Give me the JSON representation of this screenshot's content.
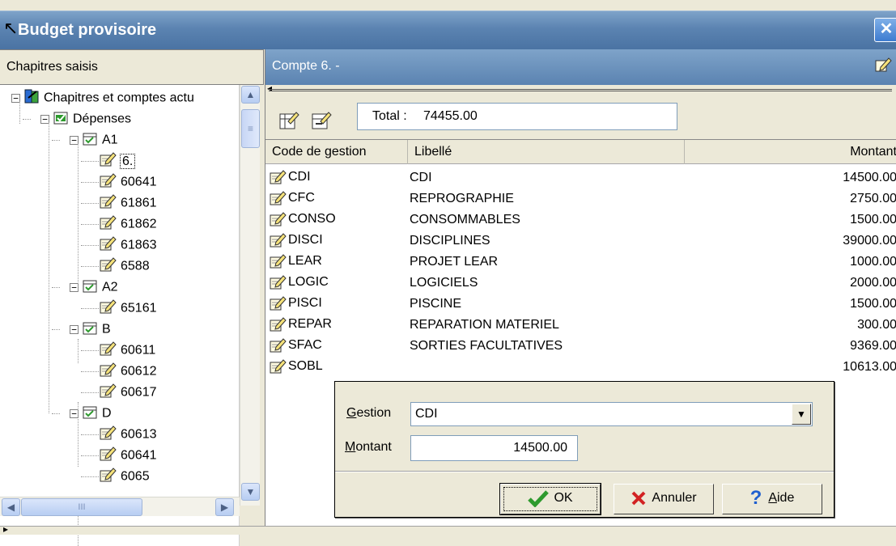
{
  "window": {
    "title": "Budget provisoire",
    "close_symbol": "✕"
  },
  "left": {
    "header": "Chapitres saisis",
    "tree": [
      {
        "level": 0,
        "expander": "−",
        "icon": "chapter-book-icon",
        "label": "Chapitres et comptes actu"
      },
      {
        "level": 1,
        "expander": "−",
        "icon": "expense-folder-icon",
        "label": "Dépenses"
      },
      {
        "level": 2,
        "expander": "−",
        "icon": "chapter-check-icon",
        "label": "A1"
      },
      {
        "level": 3,
        "expander": "",
        "icon": "account-edit-icon",
        "label": "6.",
        "selected": true
      },
      {
        "level": 3,
        "expander": "",
        "icon": "account-edit-icon",
        "label": "60641"
      },
      {
        "level": 3,
        "expander": "",
        "icon": "account-edit-icon",
        "label": "61861"
      },
      {
        "level": 3,
        "expander": "",
        "icon": "account-edit-icon",
        "label": "61862"
      },
      {
        "level": 3,
        "expander": "",
        "icon": "account-edit-icon",
        "label": "61863"
      },
      {
        "level": 3,
        "expander": "",
        "icon": "account-edit-icon",
        "label": "6588"
      },
      {
        "level": 2,
        "expander": "−",
        "icon": "chapter-check-icon",
        "label": "A2"
      },
      {
        "level": 3,
        "expander": "",
        "icon": "account-edit-icon",
        "label": "65161"
      },
      {
        "level": 2,
        "expander": "−",
        "icon": "chapter-check-icon",
        "label": "B"
      },
      {
        "level": 3,
        "expander": "",
        "icon": "account-edit-icon",
        "label": "60611"
      },
      {
        "level": 3,
        "expander": "",
        "icon": "account-edit-icon",
        "label": "60612"
      },
      {
        "level": 3,
        "expander": "",
        "icon": "account-edit-icon",
        "label": "60617"
      },
      {
        "level": 2,
        "expander": "−",
        "icon": "chapter-check-icon",
        "label": "D"
      },
      {
        "level": 3,
        "expander": "",
        "icon": "account-edit-icon",
        "label": "60613"
      },
      {
        "level": 3,
        "expander": "",
        "icon": "account-edit-icon",
        "label": "60641"
      },
      {
        "level": 3,
        "expander": "",
        "icon": "account-edit-icon",
        "label": "6065"
      }
    ],
    "hscroll_grip": "III"
  },
  "right": {
    "header": "Compte 6. -",
    "total_label": "Total :",
    "total_value": "74455.00",
    "columns": [
      "Code de gestion",
      "Libellé",
      "Montant"
    ],
    "rows": [
      {
        "code": "CDI",
        "libelle": "CDI",
        "montant": "14500.00"
      },
      {
        "code": "CFC",
        "libelle": "REPROGRAPHIE",
        "montant": "2750.00"
      },
      {
        "code": "CONSO",
        "libelle": "CONSOMMABLES",
        "montant": "1500.00"
      },
      {
        "code": "DISCI",
        "libelle": "DISCIPLINES",
        "montant": "39000.00"
      },
      {
        "code": "LEAR",
        "libelle": "PROJET LEAR",
        "montant": "1000.00"
      },
      {
        "code": "LOGIC",
        "libelle": "LOGICIELS",
        "montant": "2000.00"
      },
      {
        "code": "PISCI",
        "libelle": "PISCINE",
        "montant": "1500.00"
      },
      {
        "code": "REPAR",
        "libelle": "REPARATION MATERIEL",
        "montant": "300.00"
      },
      {
        "code": "SFAC",
        "libelle": "SORTIES FACULTATIVES",
        "montant": "9369.00"
      },
      {
        "code": "SOBL",
        "libelle": "",
        "montant": "10613.00"
      }
    ]
  },
  "dialog": {
    "gestion_label_accel": "G",
    "gestion_label_rest": "estion",
    "gestion_value": "CDI",
    "montant_label_accel": "M",
    "montant_label_rest": "ontant",
    "montant_value": "14500.00",
    "ok_label": "OK",
    "cancel_label": "Annuler",
    "help_label_accel": "A",
    "help_label_rest": "ide",
    "help_symbol": "?"
  },
  "colors": {
    "title_blue": "#5b83b1",
    "ok_green": "#2e9a2e",
    "cancel_red": "#d22222",
    "help_blue": "#1f5fcf"
  }
}
